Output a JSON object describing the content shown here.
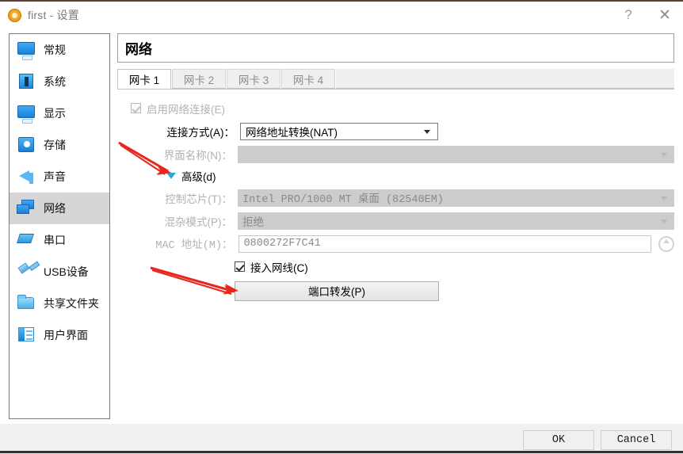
{
  "window": {
    "title": "first - 设置",
    "app_icon": "virtualbox-icon",
    "help_button": "?",
    "close_button": "✕"
  },
  "sidebar": {
    "items": [
      {
        "label": "常规",
        "icon": "monitor-icon",
        "selected": false
      },
      {
        "label": "系统",
        "icon": "system-chip-icon",
        "selected": false
      },
      {
        "label": "显示",
        "icon": "display-icon",
        "selected": false
      },
      {
        "label": "存储",
        "icon": "storage-disk-icon",
        "selected": false
      },
      {
        "label": "声音",
        "icon": "speaker-icon",
        "selected": false
      },
      {
        "label": "网络",
        "icon": "network-icon",
        "selected": true
      },
      {
        "label": "串口",
        "icon": "serial-port-icon",
        "selected": false
      },
      {
        "label": "USB设备",
        "icon": "usb-icon",
        "selected": false
      },
      {
        "label": "共享文件夹",
        "icon": "folder-icon",
        "selected": false
      },
      {
        "label": "用户界面",
        "icon": "user-interface-icon",
        "selected": false
      }
    ]
  },
  "pane": {
    "header": "网络",
    "tabs": [
      {
        "label": "网卡 1",
        "active": true
      },
      {
        "label": "网卡 2",
        "active": false
      },
      {
        "label": "网卡 3",
        "active": false
      },
      {
        "label": "网卡 4",
        "active": false
      }
    ]
  },
  "form": {
    "enable_adapter": {
      "label": "启用网络连接(E)",
      "checked": true,
      "state": "disabled"
    },
    "attached_to": {
      "label": "连接方式(A)：",
      "value": "网络地址转换(NAT)"
    },
    "interface_name": {
      "label": "界面名称(N)：",
      "value": "",
      "state": "disabled"
    },
    "advanced": {
      "label": "高级(d)",
      "expanded": true,
      "icon": "triangle-down-icon"
    },
    "adapter_type": {
      "label": "控制芯片(T)：",
      "value": "Intel PRO/1000 MT 桌面 (82540EM)",
      "state": "disabled"
    },
    "promiscuous_mode": {
      "label": "混杂模式(P)：",
      "value": "拒绝",
      "state": "disabled"
    },
    "mac_address": {
      "label": "MAC 地址(M)：",
      "value": "0800272F7C41",
      "state": "disabled",
      "refresh_icon": "refresh-mac-icon"
    },
    "cable_connected": {
      "label": "接入网线(C)",
      "checked": true
    },
    "port_forwarding_button": "端口转发(P)"
  },
  "footer": {
    "ok": "OK",
    "cancel": "Cancel"
  },
  "annotations": {
    "arrow_color": "#e8261c",
    "arrows": [
      {
        "name": "arrow-to-advanced",
        "target": "高级(d)"
      },
      {
        "name": "arrow-to-port-forwarding",
        "target": "端口转发(P)"
      }
    ]
  }
}
